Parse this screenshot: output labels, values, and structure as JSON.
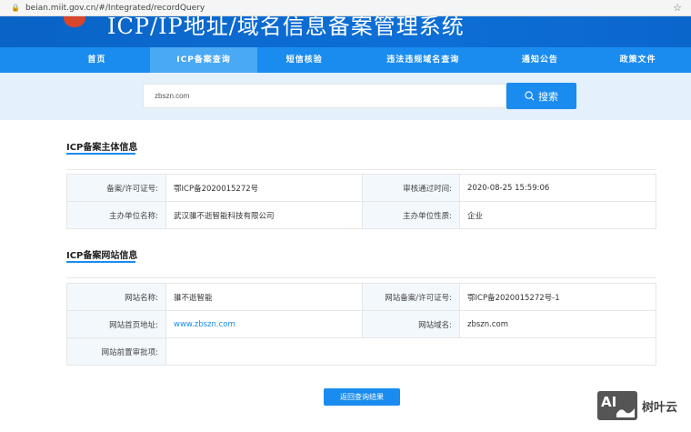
{
  "browser": {
    "url": "beian.miit.gov.cn/#/Integrated/recordQuery"
  },
  "header": {
    "title": "ICP/IP地址/域名信息备案管理系统"
  },
  "nav": {
    "items": [
      {
        "label": "首页"
      },
      {
        "label": "ICP备案查询",
        "active": true
      },
      {
        "label": "短信核验"
      },
      {
        "label": "违法违规域名查询"
      },
      {
        "label": "通知公告"
      },
      {
        "label": "政策文件"
      }
    ]
  },
  "search": {
    "value": "zbszn.com",
    "button": "搜索"
  },
  "subject": {
    "title": "ICP备案主体信息",
    "rows": [
      [
        {
          "label": "备案/许可证号:",
          "value": "鄂ICP备2020015272号"
        },
        {
          "label": "审核通过时间:",
          "value": "2020-08-25 15:59:06"
        }
      ],
      [
        {
          "label": "主办单位名称:",
          "value": "武汉骓不逝智能科技有限公司"
        },
        {
          "label": "主办单位性质:",
          "value": "企业"
        }
      ]
    ]
  },
  "website": {
    "title": "ICP备案网站信息",
    "rows": [
      [
        {
          "label": "网站名称:",
          "value": "骓不逝智能"
        },
        {
          "label": "网站备案/许可证号:",
          "value": "鄂ICP备2020015272号-1"
        }
      ],
      [
        {
          "label": "网站首页地址:",
          "value": "www.zbszn.com"
        },
        {
          "label": "网站域名:",
          "value": "zbszn.com"
        }
      ],
      [
        {
          "label": "网站前置审批项:",
          "value": ""
        }
      ]
    ]
  },
  "back_button": "返回查询结果",
  "watermark": {
    "logo": "AI",
    "text": "树叶云"
  },
  "colors": {
    "primary": "#1a8cf0",
    "banner": "#0a63c6"
  }
}
